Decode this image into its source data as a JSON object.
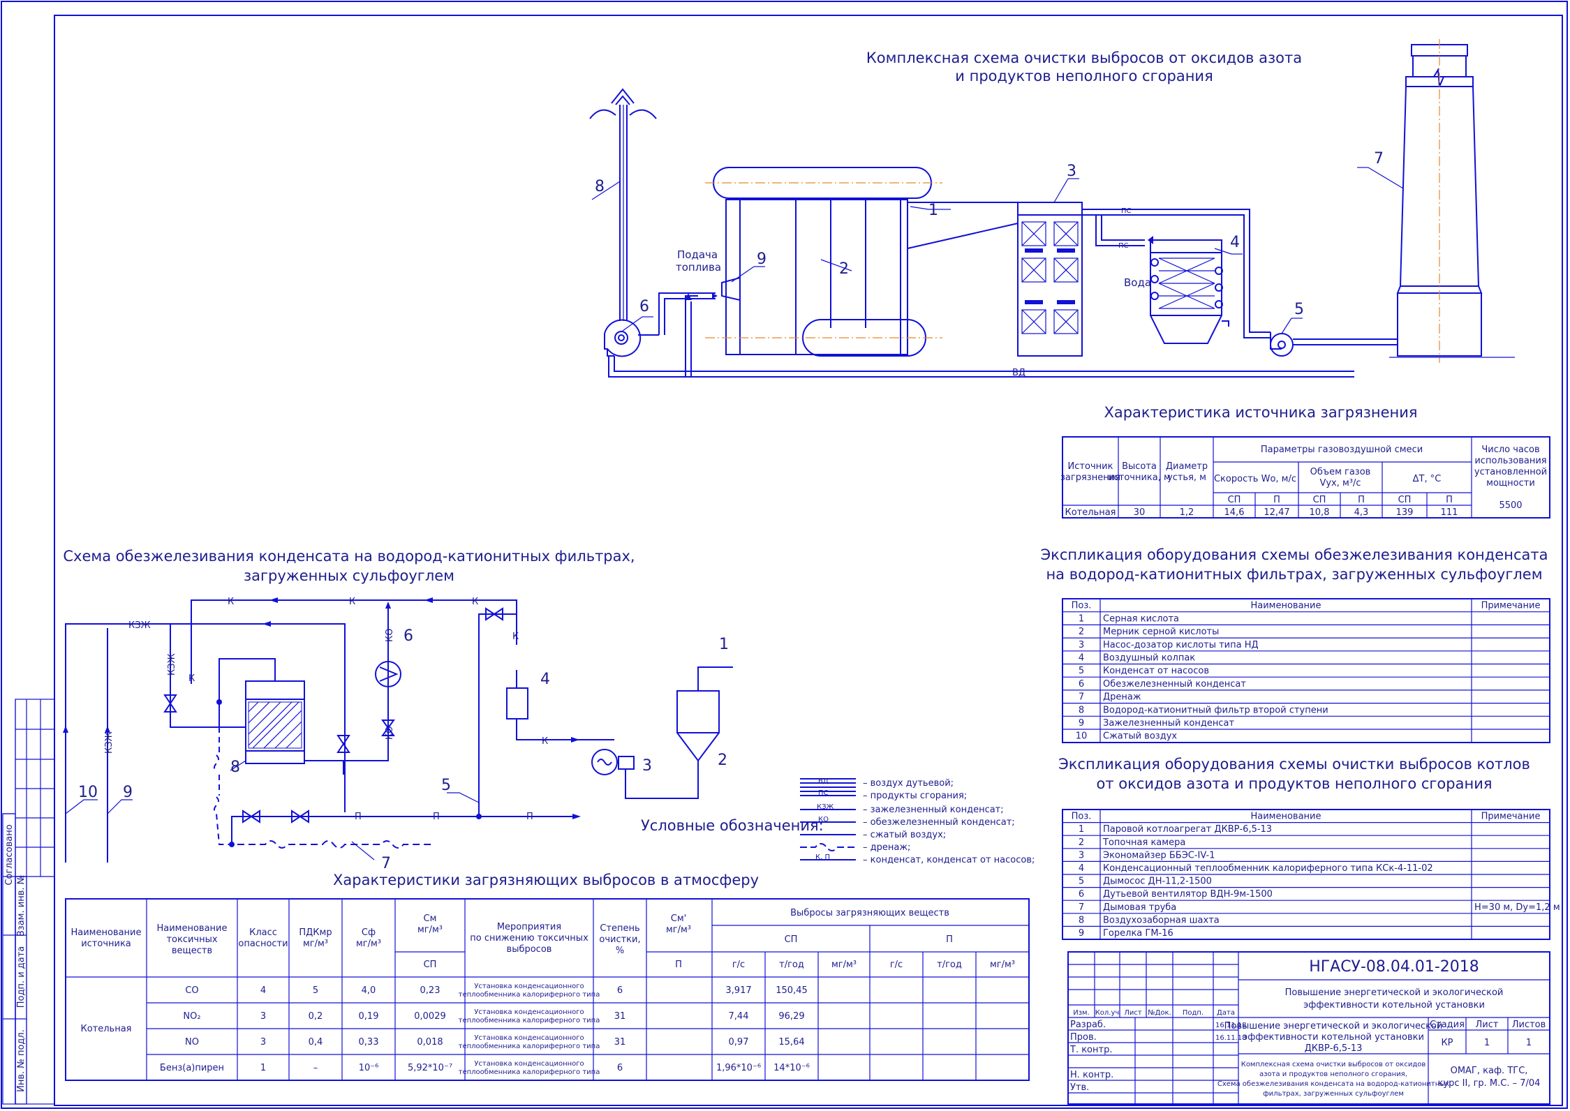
{
  "scheme1": {
    "title_line1": "Комплексная схема очистки выбросов от оксидов азота",
    "title_line2": "и продуктов неполного сгорания",
    "labels": {
      "l1": "1",
      "l2": "2",
      "l3": "3",
      "l4": "4",
      "l5": "5",
      "l6": "6",
      "l7": "7",
      "l8": "8",
      "l9": "9"
    },
    "fuel_line1": "Подача",
    "fuel_line2": "топлива",
    "water": "Вода",
    "pipe_vd": "ВД",
    "pipe_ps": "ПС",
    "pipe_ps2": "ПС"
  },
  "source_table": {
    "title": "Характеристика источника загрязнения",
    "h_source": [
      "Источник",
      "загрязнения"
    ],
    "h_height": [
      "Высота",
      "источника, м"
    ],
    "h_diam": [
      "Диаметр",
      "устья, м"
    ],
    "h_params": "Параметры газовоздушной смеси",
    "h_speed": "Скорость Wо, м/с",
    "h_volume": [
      "Объем газов",
      "Vух, м³/с"
    ],
    "h_dt": "ΔT, °С",
    "h_hours": [
      "Число часов",
      "использования",
      "установленной",
      "мощности"
    ],
    "sub": [
      "СП",
      "П",
      "СП",
      "П",
      "СП",
      "П"
    ],
    "row": [
      "Котельная",
      "30",
      "1,2",
      "14,6",
      "12,47",
      "10,8",
      "4,3",
      "139",
      "111"
    ],
    "hours": "5500"
  },
  "scheme2": {
    "title_line1": "Схема обезжелезивания конденсата на водород-катионитных фильтрах,",
    "title_line2": "загруженных сульфоуглем",
    "labels": {
      "l1": "1",
      "l2": "2",
      "l3": "3",
      "l4": "4",
      "l5": "5",
      "l6": "6",
      "l7": "7",
      "l8": "8",
      "l9": "9",
      "l10": "10"
    },
    "k": "К",
    "kzh": "КЗЖ",
    "ko": "КО",
    "p": "П"
  },
  "legend": {
    "title": "Условные обозначения:",
    "items": [
      {
        "code": "ВД",
        "text": "– воздух дутьевой;"
      },
      {
        "code": "ПС",
        "text": "– продукты сгорания;"
      },
      {
        "code": "КЗЖ",
        "text": "– зажелезненный конденсат;"
      },
      {
        "code": "КО",
        "text": "– обезжелезненный конденсат;"
      },
      {
        "code": "",
        "text": "– сжатый воздух;"
      },
      {
        "code": "",
        "text": "– дренаж;"
      },
      {
        "code": "К, П",
        "text": "– конденсат, конденсат от насосов;"
      }
    ]
  },
  "expl1": {
    "title_line1": "Экспликация оборудования схемы обезжелезивания конденсата",
    "title_line2": "на водород-катионитных фильтрах, загруженных сульфоуглем",
    "h": [
      "Поз.",
      "Наименование",
      "Примечание"
    ],
    "rows": [
      [
        "1",
        "Серная кислота",
        ""
      ],
      [
        "2",
        "Мерник серной кислоты",
        ""
      ],
      [
        "3",
        "Насос-дозатор кислоты типа НД",
        ""
      ],
      [
        "4",
        "Воздушный колпак",
        ""
      ],
      [
        "5",
        "Конденсат от насосов",
        ""
      ],
      [
        "6",
        "Обезжелезненный конденсат",
        ""
      ],
      [
        "7",
        "Дренаж",
        ""
      ],
      [
        "8",
        "Водород-катионитный фильтр второй ступени",
        ""
      ],
      [
        "9",
        "Зажелезненный конденсат",
        ""
      ],
      [
        "10",
        "Сжатый воздух",
        ""
      ]
    ]
  },
  "expl2": {
    "title_line1": "Экспликация оборудования схемы очистки выбросов котлов",
    "title_line2": "от оксидов азота и продуктов неполного сгорания",
    "h": [
      "Поз.",
      "Наименование",
      "Примечание"
    ],
    "rows": [
      [
        "1",
        "Паровой котлоагрегат ДКВР-6,5-13",
        ""
      ],
      [
        "2",
        "Топочная камера",
        ""
      ],
      [
        "3",
        "Экономайзер ББЭС-IV-1",
        ""
      ],
      [
        "4",
        "Конденсационный теплообменник калориферного типа КСк-4-11-02",
        ""
      ],
      [
        "5",
        "Дымосос ДН-11,2-1500",
        ""
      ],
      [
        "6",
        "Дутьевой вентилятор ВДН-9м-1500",
        ""
      ],
      [
        "7",
        "Дымовая труба",
        "H=30 м, Dу=1,2 м"
      ],
      [
        "8",
        "Воздухозаборная шахта",
        ""
      ],
      [
        "9",
        "Горелка ГМ-16",
        ""
      ]
    ]
  },
  "emis_table": {
    "title": "Характеристики загрязняющих выбросов в атмосферу",
    "h_source": [
      "Наименование",
      "источника"
    ],
    "h_name": [
      "Наименование",
      "токсичных",
      "веществ"
    ],
    "h_class": [
      "Класс",
      "опасности"
    ],
    "h_pdk": [
      "ПДКмр",
      "мг/м³"
    ],
    "h_sf": [
      "Сф",
      "мг/м³"
    ],
    "h_sm": [
      "См",
      "мг/м³"
    ],
    "h_meas": [
      "Мероприятия",
      "по снижению токсичных",
      "выбросов"
    ],
    "h_deg": [
      "Степень",
      "очистки,",
      "%"
    ],
    "h_sm2": [
      "См'",
      "мг/м³"
    ],
    "h_emis": "Выбросы загрязняющих веществ",
    "sp": "СП",
    "p": "П",
    "units": [
      "г/с",
      "т/год",
      "мг/м³",
      "г/с",
      "т/год",
      "мг/м³"
    ],
    "source": "Котельная",
    "rows": [
      {
        "name": "CO",
        "cls": "4",
        "pdk": "5",
        "sf": "4,0",
        "sm": "0,23",
        "meas": [
          "Установка конденсационного",
          "теплообменника калориферного типа"
        ],
        "deg": "6",
        "gs": "3,917",
        "ty": "150,45"
      },
      {
        "name": "NO₂",
        "cls": "3",
        "pdk": "0,2",
        "sf": "0,19",
        "sm": "0,0029",
        "meas": [
          "Установка конденсационного",
          "теплообменника калориферного типа"
        ],
        "deg": "31",
        "gs": "7,44",
        "ty": "96,29"
      },
      {
        "name": "NO",
        "cls": "3",
        "pdk": "0,4",
        "sf": "0,33",
        "sm": "0,018",
        "meas": [
          "Установка конденсационного",
          "теплообменника калориферного типа"
        ],
        "deg": "31",
        "gs": "0,97",
        "ty": "15,64"
      },
      {
        "name": "Бенз(а)пирен",
        "cls": "1",
        "pdk": "–",
        "sf": "10⁻⁶",
        "sm": "5,92*10⁻⁷",
        "meas": [
          "Установка конденсационного",
          "теплообменника калориферного типа"
        ],
        "deg": "6",
        "gs": "1,96*10⁻⁶",
        "ty": "14*10⁻⁶"
      }
    ]
  },
  "stamp": {
    "code": "НГАСУ-08.04.01-2018",
    "topic_line1": "Повышение энергетической и экологической",
    "topic_line2": "эффективности котельной установки",
    "h": [
      "Изм.",
      "Кол.уч",
      "Лист",
      "№Док.",
      "Подп.",
      "Дата"
    ],
    "roles": [
      "Разраб.",
      "Пров.",
      "Т. контр.",
      "",
      "Н. контр.",
      "Утв."
    ],
    "dates": [
      "16.11.18",
      "16.11.18"
    ],
    "work_line1": "Повышение энергетической и экологической",
    "work_line2": "эффективности котельной установки",
    "work_line3": "ДКВР-6,5-13",
    "stage_h": "Стадия",
    "sheet_h": "Лист",
    "sheets_h": "Листов",
    "stage": "КР",
    "sheet": "1",
    "sheets": "1",
    "content_line1": "Комплексная схема очистки выбросов от оксидов",
    "content_line2": "азота и продуктов неполного сгорания,",
    "content_line3": "Схема обезжелезивания конденсата на водород-катионитных",
    "content_line4": "фильтрах, загруженных сульфоуглем",
    "org_line1": "ОМАГ, каф. ТГС,",
    "org_line2": "курс II, гр. М.С. – 7/04"
  },
  "side": {
    "agreed": "Согласовано",
    "vzam": "Взам. инв. №",
    "podp": "Подп. и дата",
    "inv": "Инв. № подл."
  }
}
